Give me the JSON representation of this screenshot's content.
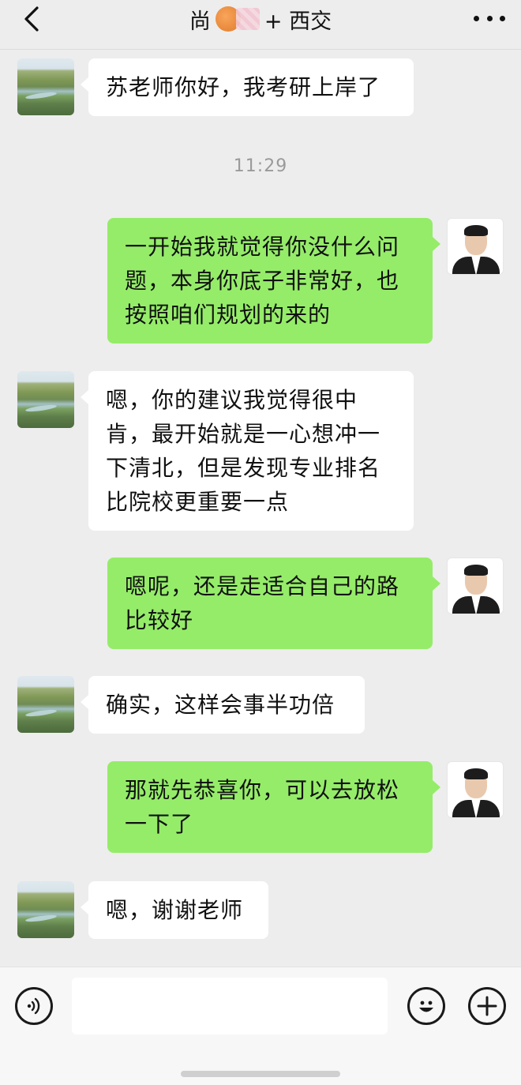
{
  "header": {
    "title_left": "尚",
    "title_right": "+ 西交",
    "back_icon": "chevron-left-icon",
    "more_icon": "more-dots-icon"
  },
  "messages": [
    {
      "side": "in",
      "text": "苏老师你好，我考研上岸了"
    },
    {
      "side": "out",
      "text": "一开始我就觉得你没什么问题，本身你底子非常好，也按照咱们规划的来的"
    },
    {
      "side": "in",
      "text": "嗯，你的建议我觉得很中肯，最开始就是一心想冲一下清北，但是发现专业排名比院校更重要一点"
    },
    {
      "side": "out",
      "text": "嗯呢，还是走适合自己的路比较好"
    },
    {
      "side": "in",
      "text": "确实，这样会事半功倍"
    },
    {
      "side": "out",
      "text": "那就先恭喜你，可以去放松一下了"
    },
    {
      "side": "in",
      "text": "嗯，谢谢老师"
    }
  ],
  "timestamp": "11:29",
  "footer": {
    "input_value": "",
    "voice_icon": "voice-icon",
    "emoji_icon": "emoji-icon",
    "plus_icon": "plus-icon"
  },
  "colors": {
    "background": "#ededed",
    "incoming_bubble": "#ffffff",
    "outgoing_bubble": "#95ec69"
  }
}
